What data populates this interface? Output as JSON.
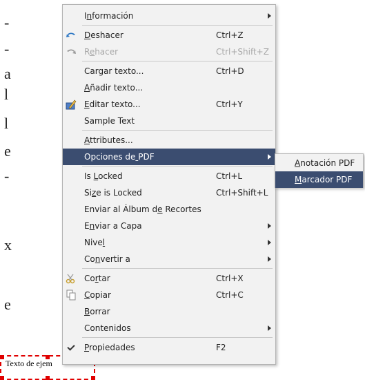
{
  "background": {
    "doc_text": "Texto de ejem"
  },
  "menu": {
    "items": [
      {
        "label": "Información",
        "mnemonic_index": 1,
        "accel": "",
        "submenu": true,
        "disabled": false,
        "icon": ""
      },
      {
        "sep": true
      },
      {
        "label": "Deshacer",
        "mnemonic_index": 0,
        "accel": "Ctrl+Z",
        "submenu": false,
        "disabled": false,
        "icon": "undo-icon"
      },
      {
        "label": "Rehacer",
        "mnemonic_index": 1,
        "accel": "Ctrl+Shift+Z",
        "submenu": false,
        "disabled": true,
        "icon": "redo-icon"
      },
      {
        "sep": true
      },
      {
        "label": "Cargar texto...",
        "mnemonic_index": -1,
        "accel": "Ctrl+D",
        "submenu": false,
        "disabled": false,
        "icon": ""
      },
      {
        "label": "Añadir texto...",
        "mnemonic_index": 0,
        "accel": "",
        "submenu": false,
        "disabled": false,
        "icon": ""
      },
      {
        "label": "Editar texto...",
        "mnemonic_index": 0,
        "accel": "Ctrl+Y",
        "submenu": false,
        "disabled": false,
        "icon": "edit-text-icon"
      },
      {
        "label": "Sample Text",
        "mnemonic_index": -1,
        "accel": "",
        "submenu": false,
        "disabled": false,
        "icon": ""
      },
      {
        "sep": true
      },
      {
        "label": "Attributes...",
        "mnemonic_index": 0,
        "accel": "",
        "submenu": false,
        "disabled": false,
        "icon": ""
      },
      {
        "label": "Opciones de PDF",
        "mnemonic_index": 11,
        "accel": "",
        "submenu": true,
        "disabled": false,
        "icon": "",
        "highlight": true
      },
      {
        "sep": true
      },
      {
        "label": "Is Locked",
        "mnemonic_index": 3,
        "accel": "Ctrl+L",
        "submenu": false,
        "disabled": false,
        "icon": ""
      },
      {
        "label": "Size is Locked",
        "mnemonic_index": 2,
        "accel": "Ctrl+Shift+L",
        "submenu": false,
        "disabled": false,
        "icon": ""
      },
      {
        "label": "Enviar al Álbum de Recortes",
        "mnemonic_index": 17,
        "accel": "",
        "submenu": false,
        "disabled": false,
        "icon": ""
      },
      {
        "label": "Enviar a Capa",
        "mnemonic_index": 1,
        "accel": "",
        "submenu": true,
        "disabled": false,
        "icon": ""
      },
      {
        "label": "Nivel",
        "mnemonic_index": 4,
        "accel": "",
        "submenu": true,
        "disabled": false,
        "icon": ""
      },
      {
        "label": "Convertir a",
        "mnemonic_index": 2,
        "accel": "",
        "submenu": true,
        "disabled": false,
        "icon": ""
      },
      {
        "sep": true
      },
      {
        "label": "Cortar",
        "mnemonic_index": 2,
        "accel": "Ctrl+X",
        "submenu": false,
        "disabled": false,
        "icon": "cut-icon"
      },
      {
        "label": "Copiar",
        "mnemonic_index": 0,
        "accel": "Ctrl+C",
        "submenu": false,
        "disabled": false,
        "icon": "copy-icon"
      },
      {
        "label": "Borrar",
        "mnemonic_index": 0,
        "accel": "",
        "submenu": false,
        "disabled": false,
        "icon": ""
      },
      {
        "label": "Contenidos",
        "mnemonic_index": -1,
        "accel": "",
        "submenu": true,
        "disabled": false,
        "icon": ""
      },
      {
        "sep": true
      },
      {
        "label": "Propiedades",
        "mnemonic_index": 0,
        "accel": "F2",
        "submenu": false,
        "disabled": false,
        "icon": "checkmark-icon"
      }
    ]
  },
  "submenu": {
    "items": [
      {
        "label": "Anotación PDF",
        "mnemonic_index": 0,
        "highlight": false
      },
      {
        "label": "Marcador PDF",
        "mnemonic_index": 0,
        "highlight": true
      }
    ]
  },
  "colors": {
    "highlight_bg": "#3b4d70",
    "menu_bg": "#f2f2f2",
    "disabled_text": "#a8a8a8",
    "selection_frame": "#e00000"
  }
}
